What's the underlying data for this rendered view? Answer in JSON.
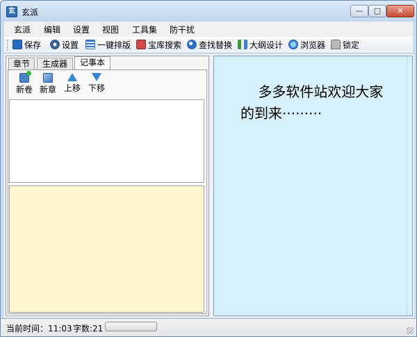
{
  "window": {
    "title": "玄派",
    "app_icon_glyph": "玄",
    "controls": {
      "minimize": "—",
      "maximize": "□",
      "close": "✕"
    }
  },
  "menu": {
    "items": [
      "玄派",
      "编辑",
      "设置",
      "视图",
      "工具集",
      "防干扰"
    ]
  },
  "toolbar": {
    "items": [
      {
        "label": "保存",
        "icon": "save-icon"
      },
      {
        "label": "设置",
        "icon": "gear-icon"
      },
      {
        "label": "一键排版",
        "icon": "layout-icon"
      },
      {
        "label": "宝库搜索",
        "icon": "repository-icon"
      },
      {
        "label": "查找替换",
        "icon": "find-replace-icon"
      },
      {
        "label": "大纲设计",
        "icon": "outline-icon"
      },
      {
        "label": "浏览器",
        "icon": "browser-icon"
      },
      {
        "label": "锁定",
        "icon": "lock-icon"
      }
    ]
  },
  "left_panel": {
    "tabs": [
      {
        "label": "章节",
        "active": false
      },
      {
        "label": "生成器",
        "active": false
      },
      {
        "label": "记事本",
        "active": true
      }
    ],
    "tools": [
      {
        "label": "新卷",
        "icon": "new-volume-icon"
      },
      {
        "label": "新章",
        "icon": "new-chapter-icon"
      },
      {
        "label": "上移",
        "icon": "move-up-icon"
      },
      {
        "label": "下移",
        "icon": "move-down-icon"
      }
    ],
    "note_background": "#fff8cf"
  },
  "editor": {
    "text": "    多多软件站欢迎大家的到来·········",
    "background": "#d8f0fb"
  },
  "status": {
    "time_label": "当前时间：11:03",
    "word_count_label": "字数:21",
    "progress": 0.0
  }
}
